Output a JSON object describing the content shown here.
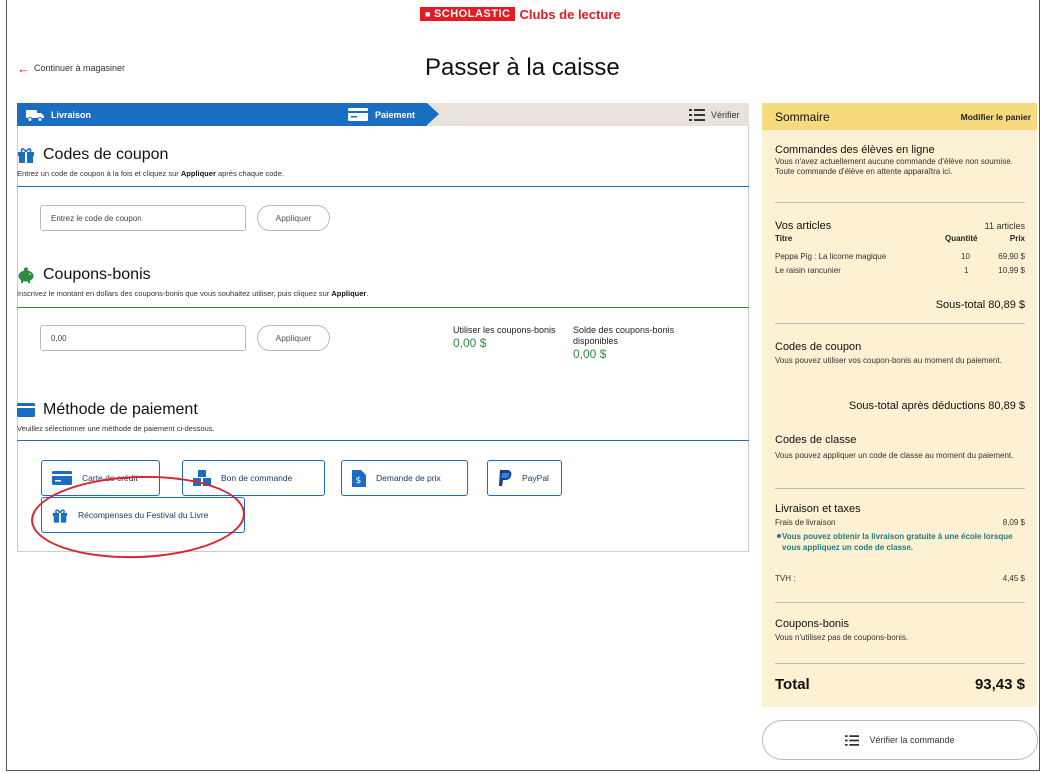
{
  "header": {
    "brand_name": "SCHOLASTIC",
    "brand_sub": "Clubs de lecture",
    "back_link": "Continuer à magasiner",
    "page_title": "Passer à la caisse"
  },
  "stepper": {
    "steps": [
      {
        "label": "Livraison",
        "icon": "truck-icon",
        "state": "completed"
      },
      {
        "label": "Paiement",
        "icon": "card-icon",
        "state": "active"
      },
      {
        "label": "Vérifier",
        "icon": "list-icon",
        "state": "upcoming"
      }
    ]
  },
  "coupon_codes": {
    "title": "Codes de coupon",
    "desc_pre": "Entrez un code de coupon à la fois et cliquez sur ",
    "desc_bold": "Appliquer",
    "desc_post": " après chaque code.",
    "input_placeholder": "Entrez le code de coupon",
    "apply_label": "Appliquer"
  },
  "bonus_coupons": {
    "title": "Coupons-bonis",
    "desc_pre": "Inscrivez le montant en dollars des coupons-bonis que vous souhaitez utiliser, puis cliquez sur ",
    "desc_bold": "Appliquer",
    "desc_post": ".",
    "input_value": "0,00",
    "apply_label": "Appliquer",
    "use_label": "Utiliser les coupons-bonis",
    "use_value": "0,00 $",
    "balance_label": "Solde des coupons-bonis disponibles",
    "balance_value": "0,00 $"
  },
  "payment_method": {
    "title": "Méthode de paiement",
    "desc": "Veuillez sélectionner une méthode de paiement ci-dessous.",
    "options": [
      {
        "label": "Carte de crédit",
        "icon": "credit-card-icon"
      },
      {
        "label": "Bon de commande",
        "icon": "boxes-icon"
      },
      {
        "label": "Demande de prix",
        "icon": "document-dollar-icon"
      },
      {
        "label": "PayPal",
        "icon": "paypal-icon"
      },
      {
        "label": "Récompenses du Festival du Livre",
        "icon": "gift-icon"
      }
    ]
  },
  "summary": {
    "title": "Sommaire",
    "edit_cart": "Modifier le panier",
    "student_orders": {
      "title": "Commandes des élèves en ligne",
      "text": "Vous n'avez actuellement aucune commande d'élève non soumise. Toute commande d'élève en attente apparaîtra ici."
    },
    "items": {
      "title": "Vos articles",
      "count": "11 articles",
      "col_title": "Titre",
      "col_qty": "Quantité",
      "col_price": "Prix",
      "rows": [
        {
          "title": "Peppa Pig : La licorne magique",
          "qty": "10",
          "price": "69,90 $"
        },
        {
          "title": "Le raisin rancunier",
          "qty": "1",
          "price": "10,99 $"
        }
      ],
      "subtotal": "Sous-total 80,89 $"
    },
    "coupon_codes": {
      "title": "Codes de coupon",
      "text": "Vous pouvez utiliser vos coupon-bonis au moment du paiement.",
      "subtotal_after": "Sous-total après déductions 80,89 $"
    },
    "class_codes": {
      "title": "Codes de classe",
      "text": "Vous pouvez appliquer un code de classe au moment du paiement."
    },
    "shipping": {
      "title": "Livraison et taxes",
      "fee_label": "Frais de livraison",
      "fee_value": "8,09 $",
      "note": "Vous pouvez obtenir la livraison gratuite à une école lorsque vous appliquez un code de classe.",
      "tax_label": "TVH :",
      "tax_value": "4,45 $"
    },
    "bonus": {
      "title": "Coupons-bonis",
      "text": "Vous n'utilisez pas de coupons-bonis."
    },
    "total_label": "Total",
    "total_value": "93,43 $"
  },
  "verify_order_label": "Vérifier la commande",
  "colors": {
    "accent": "#1a6ec2",
    "brand_red": "#e31b23",
    "summary_bg": "#fcf1d2",
    "summary_head": "#f7d97e",
    "positive": "#2e8b3d"
  }
}
